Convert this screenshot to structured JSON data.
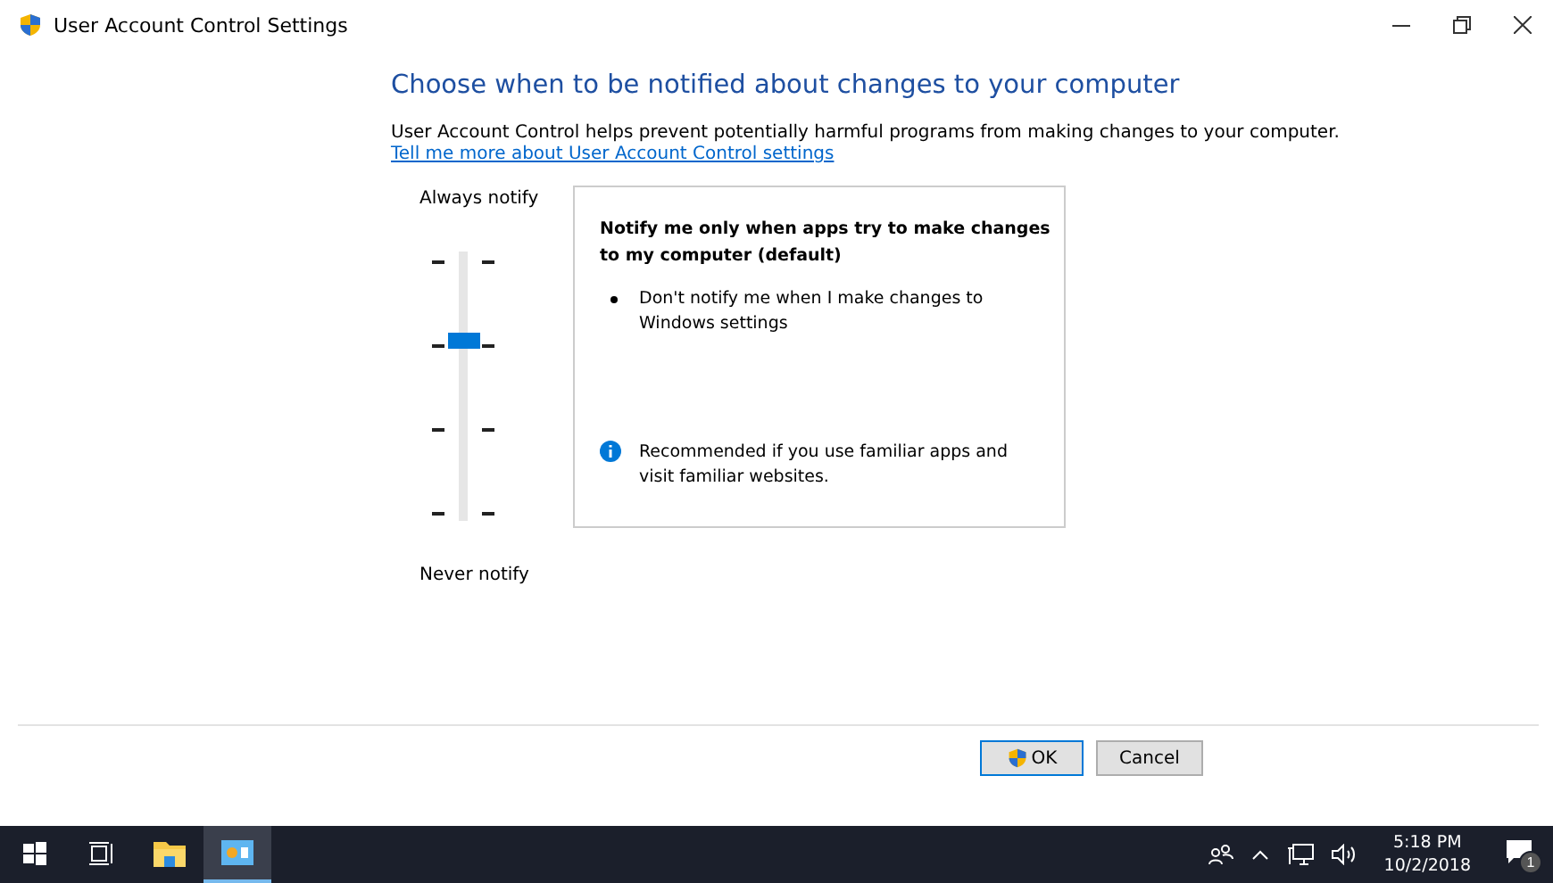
{
  "window": {
    "title": "User Account Control Settings"
  },
  "heading": "Choose when to be notified about changes to your computer",
  "description": "User Account Control helps prevent potentially harmful programs from making changes to your computer.",
  "link": "Tell me more about User Account Control settings",
  "slider": {
    "top_label": "Always notify",
    "bottom_label": "Never notify",
    "level": 0.667
  },
  "info": {
    "title": "Notify me only when apps try to make changes to my computer (default)",
    "bullets": [
      "Don't notify me when I make changes to Windows settings"
    ],
    "note": "Recommended if you use familiar apps and visit familiar websites."
  },
  "buttons": [
    {
      "label": "OK",
      "kind": "primary"
    },
    {
      "label": "Cancel",
      "kind": "normal"
    }
  ],
  "taskbar": {
    "apps": [
      {
        "kind": "start",
        "selected": false
      },
      {
        "kind": "taskview",
        "selected": false
      },
      {
        "kind": "explorer",
        "selected": false
      },
      {
        "kind": "uac",
        "selected": true
      }
    ],
    "time": "5:18 PM",
    "date": "10/2/2018",
    "notifications": "1"
  }
}
